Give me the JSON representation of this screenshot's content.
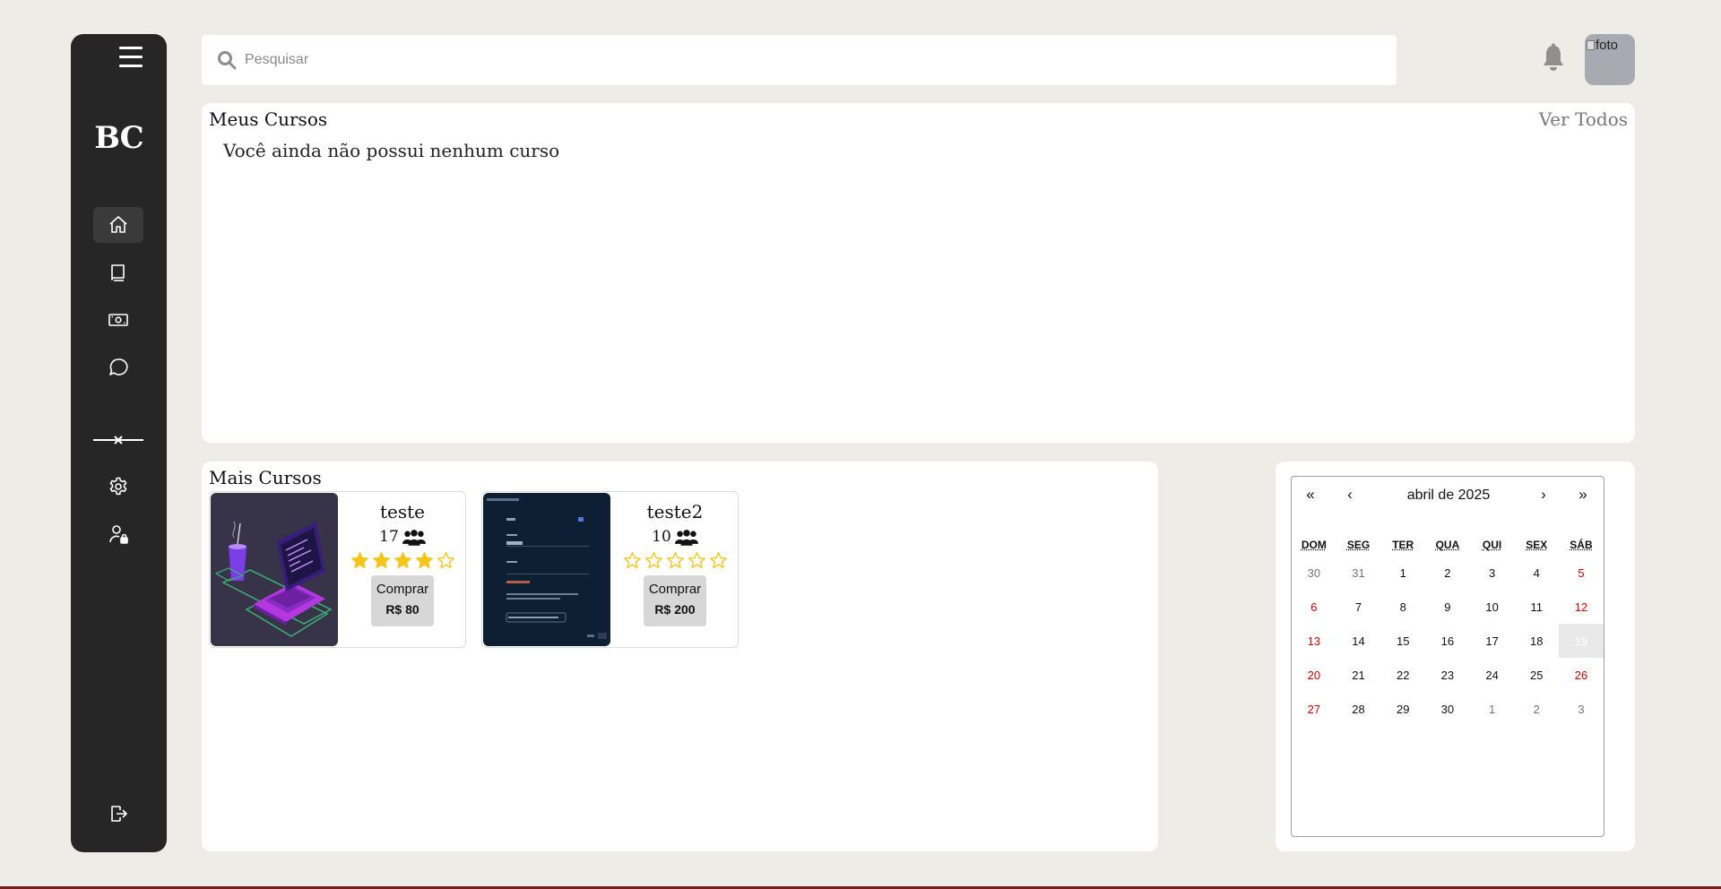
{
  "sidebar": {
    "logo": "BC",
    "nav_items": [
      {
        "icon": "home-icon"
      },
      {
        "icon": "book-icon"
      },
      {
        "icon": "money-icon"
      },
      {
        "icon": "chat-icon"
      },
      {
        "icon": "settings-icon"
      },
      {
        "icon": "user-lock-icon"
      },
      {
        "icon": "logout-icon"
      }
    ]
  },
  "header": {
    "search_placeholder": "Pesquisar",
    "avatar_alt": "foto"
  },
  "my_courses": {
    "title": "Meus Cursos",
    "see_all": "Ver Todos",
    "empty_message": "Você ainda não possui nenhum curso"
  },
  "more_courses": {
    "title": "Mais Cursos",
    "courses": [
      {
        "name": "teste",
        "students": "17",
        "rating": 4,
        "buy_label": "Comprar",
        "price": "R$ 80"
      },
      {
        "name": "teste2",
        "students": "10",
        "rating": 0,
        "buy_label": "Comprar",
        "price": "R$ 200"
      }
    ]
  },
  "calendar": {
    "title": "abril de 2025",
    "nav": {
      "prev_year": "«",
      "prev_month": "‹",
      "next_month": "›",
      "next_year": "»"
    },
    "weekdays": [
      "DOM",
      "SEG",
      "TER",
      "QUA",
      "QUI",
      "SEX",
      "SÁB"
    ],
    "weeks": [
      [
        "30",
        "31",
        "1",
        "2",
        "3",
        "4",
        "5"
      ],
      [
        "6",
        "7",
        "8",
        "9",
        "10",
        "11",
        "12"
      ],
      [
        "13",
        "14",
        "15",
        "16",
        "17",
        "18",
        "19"
      ],
      [
        "20",
        "21",
        "22",
        "23",
        "24",
        "25",
        "26"
      ],
      [
        "27",
        "28",
        "29",
        "30",
        "1",
        "2",
        "3"
      ]
    ],
    "today": "19"
  },
  "colors": {
    "sidebar_bg": "#262626",
    "page_bg": "#edece6",
    "star": "#f5c518",
    "weekend": "#d10000"
  }
}
